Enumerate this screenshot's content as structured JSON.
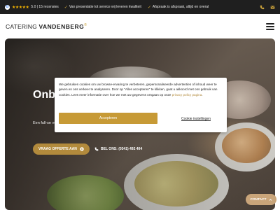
{
  "topbar": {
    "google_letter": "G",
    "stars": "★★★★★",
    "rating": "5.0 | 15 recensies",
    "usps": [
      "Van presentatie tot service wij leveren kwaliteit",
      "Afspraak is afspraak, altijd en overal"
    ],
    "icons": [
      "phone-icon",
      "mail-icon"
    ]
  },
  "header": {
    "logo_light": "CATERING ",
    "logo_bold": "VANDENBERG",
    "logo_mark": "®"
  },
  "hero": {
    "title": "Onbe uitge",
    "text": "Een full-se voor verrass",
    "cta_label": "VRAAG OFFERTE AAN",
    "phone_label": "BEL ONS: (0341) 492 404"
  },
  "cookie": {
    "text": "We gebruiken cookies om uw browse-ervaring te verbeteren, gepersonaliseerde advertenties of inhoud weer te geven en ons verkeer te analyseren. Door op \"Alles accepteren\" te klikken, gaat u akkoord met ons gebruik van cookies. Lees meer informatie over hoe we met uw gegevens omgaan op onze ",
    "link": "privacy policy pagina",
    "link_suffix": ".",
    "accept_label": "Accepteren",
    "settings_label": "Cookie instellingen"
  },
  "contact": {
    "label": "CONTACT"
  },
  "colors": {
    "gold": "#c79a36",
    "dark": "#1f1f1f"
  }
}
